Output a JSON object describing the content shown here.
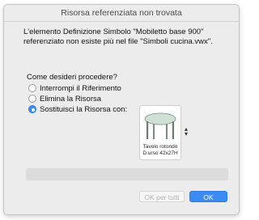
{
  "dialog": {
    "title": "Risorsa referenziata non trovata",
    "message_line1": "L'elemento Definizione Simbolo \"Mobiletto base 900\"",
    "message_line2": "referenziato non esiste più nel file \"Simboli cucina.vwx\".",
    "question": "Come desideri procedere?",
    "options": [
      {
        "label": "Interrompi il Riferimento",
        "selected": false
      },
      {
        "label": "Elimina la Risorsa",
        "selected": false
      },
      {
        "label": "Sostituisci la Risorsa con:",
        "selected": true
      }
    ],
    "resource": {
      "name_line1": "Tavolo rotondo",
      "name_line2": "D.urso 42x27H"
    },
    "buttons": {
      "ok_all": "OK per tutti",
      "ok": "OK"
    }
  },
  "colors": {
    "accent": "#3c8bf2",
    "dialog_bg": "#ececec",
    "table_top": "#cfe0d4",
    "table_legs": "#6c7a72"
  }
}
